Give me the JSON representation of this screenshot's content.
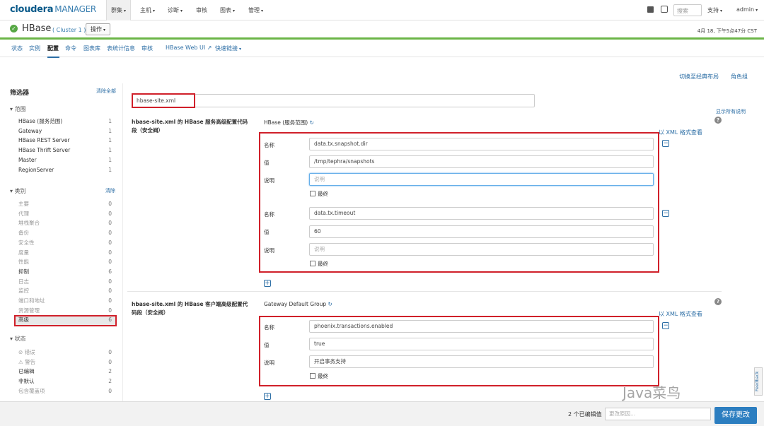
{
  "brand": {
    "name": "cloudera",
    "product": "MANAGER"
  },
  "topnav": {
    "items": [
      {
        "label": "群集"
      },
      {
        "label": "主机"
      },
      {
        "label": "诊断"
      },
      {
        "label": "审核"
      },
      {
        "label": "图表"
      },
      {
        "label": "管理"
      }
    ],
    "search_placeholder": "搜索",
    "support": "支持",
    "user": "admin"
  },
  "service": {
    "name": "HBase",
    "cluster": "( Cluster 1 )",
    "ops_label": "操作",
    "time": "4月 18, 下午5点47分 CST"
  },
  "subtabs": [
    {
      "label": "状态"
    },
    {
      "label": "实例"
    },
    {
      "label": "配置"
    },
    {
      "label": "命令"
    },
    {
      "label": "图表库"
    },
    {
      "label": "表统计信息"
    },
    {
      "label": "审核"
    },
    {
      "label": "HBase Web UI"
    },
    {
      "label": "快速链接"
    }
  ],
  "links": {
    "classic_layout": "切换至经典布局",
    "role_groups": "角色组",
    "show_all_desc": "显示所有说明",
    "xml_view": "以 XML 格式查看"
  },
  "filter": {
    "title": "筛选器",
    "clear_all": "清除全部",
    "scope": {
      "title": "范围",
      "items": [
        {
          "label": "HBase (服务范围)",
          "count": "1"
        },
        {
          "label": "Gateway",
          "count": "1"
        },
        {
          "label": "HBase REST Server",
          "count": "1"
        },
        {
          "label": "HBase Thrift Server",
          "count": "1"
        },
        {
          "label": "Master",
          "count": "1"
        },
        {
          "label": "RegionServer",
          "count": "1"
        }
      ]
    },
    "category": {
      "title": "类别",
      "clear": "清除",
      "items": [
        {
          "label": "主要",
          "count": "0"
        },
        {
          "label": "代理",
          "count": "0"
        },
        {
          "label": "堆栈聚合",
          "count": "0"
        },
        {
          "label": "备份",
          "count": "0"
        },
        {
          "label": "安全性",
          "count": "0"
        },
        {
          "label": "度量",
          "count": "0"
        },
        {
          "label": "性能",
          "count": "0"
        },
        {
          "label": "抑制",
          "count": "6"
        },
        {
          "label": "日志",
          "count": "0"
        },
        {
          "label": "监控",
          "count": "0"
        },
        {
          "label": "端口和地址",
          "count": "0"
        },
        {
          "label": "资源管理",
          "count": "0"
        },
        {
          "label": "高级",
          "count": "6"
        }
      ]
    },
    "status": {
      "title": "状态",
      "items": [
        {
          "label": "错误",
          "count": "0"
        },
        {
          "label": "警告",
          "count": "0"
        },
        {
          "label": "已编辑",
          "count": "2"
        },
        {
          "label": "非默认",
          "count": "2"
        },
        {
          "label": "包含覆盖项",
          "count": "0"
        }
      ]
    }
  },
  "search": {
    "value": "hbase-site.xml"
  },
  "config1": {
    "title": "hbase-site.xml 的 HBase 服务高级配置代码段（安全阀）",
    "scope": "HBase (服务范围)",
    "labels": {
      "name": "名称",
      "value": "值",
      "desc": "说明",
      "final": "最终"
    },
    "entries": [
      {
        "name": "data.tx.snapshot.dir",
        "value": "/tmp/tephra/snapshots",
        "desc_placeholder": "说明"
      },
      {
        "name": "data.tx.timeout",
        "value": "60",
        "desc_placeholder": "说明"
      }
    ]
  },
  "config2": {
    "title": "hbase-site.xml 的 HBase 客户端高级配置代码段（安全阀）",
    "scope": "Gateway Default Group",
    "entries": [
      {
        "name": "phoenix.transactions.enabled",
        "value": "true",
        "desc": "开启事务支持"
      }
    ]
  },
  "bottom": {
    "edited": "2 个已编辑值",
    "reason_placeholder": "更改原因...",
    "save": "保存更改"
  },
  "feedback": "Feedback",
  "watermark": "Java菜鸟"
}
